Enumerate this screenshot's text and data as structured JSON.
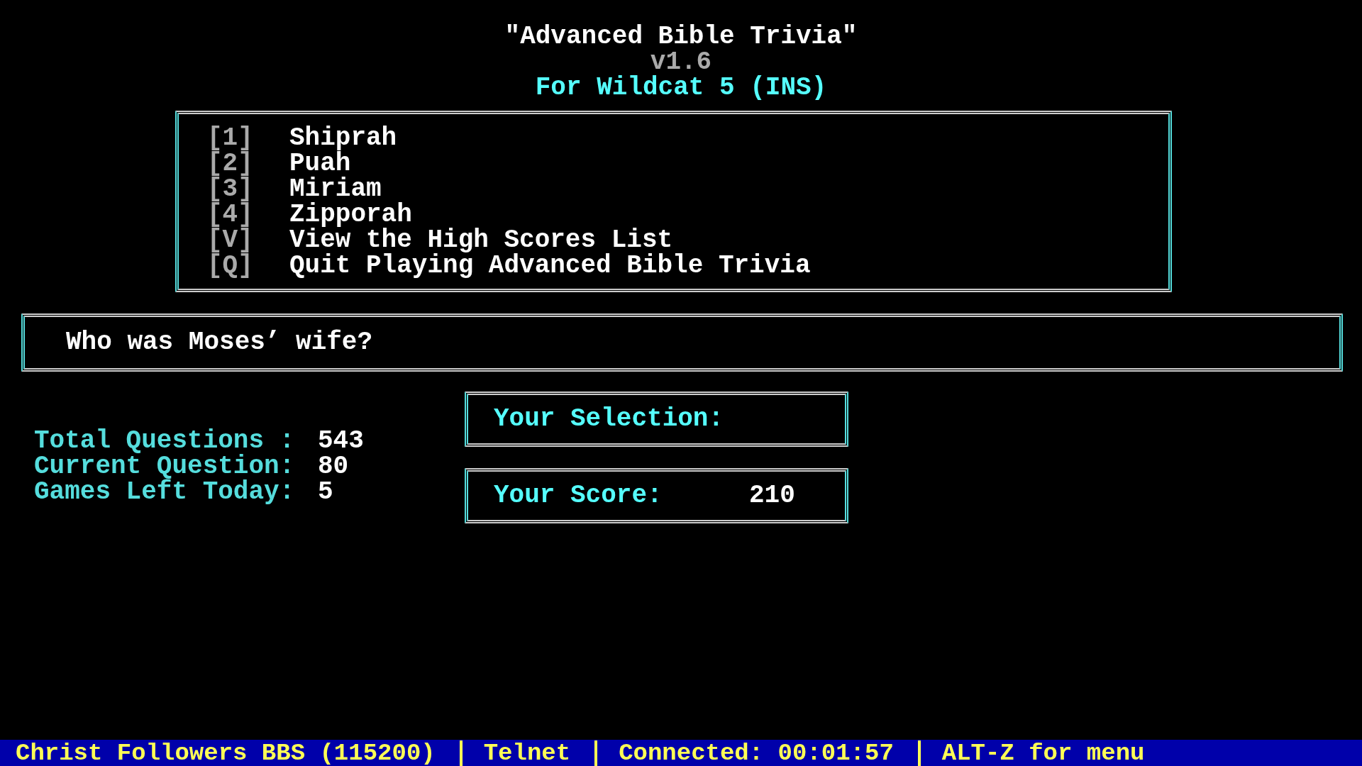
{
  "header": {
    "title": "\"Advanced Bible Trivia\"",
    "version": "v1.6",
    "subtitle": "For Wildcat 5 (INS)"
  },
  "menu": [
    {
      "key": "[1]",
      "label": "Shiprah"
    },
    {
      "key": "[2]",
      "label": "Puah"
    },
    {
      "key": "[3]",
      "label": "Miriam"
    },
    {
      "key": "[4]",
      "label": "Zipporah"
    },
    {
      "key": "[V]",
      "label": "View the High Scores List"
    },
    {
      "key": "[Q]",
      "label": "Quit Playing Advanced Bible Trivia"
    }
  ],
  "question": "Who was Moses’ wife?",
  "stats": [
    {
      "label": "Total Questions :",
      "value": "543"
    },
    {
      "label": "Current Question:",
      "value": "80"
    },
    {
      "label": "Games Left Today:",
      "value": "5"
    }
  ],
  "selection": {
    "label": "Your Selection:"
  },
  "score": {
    "label": "Your Score:",
    "value": "210"
  },
  "status_bar": [
    "Christ Followers BBS (115200)",
    "Telnet",
    "Connected: 00:01:57",
    "ALT-Z for menu"
  ]
}
